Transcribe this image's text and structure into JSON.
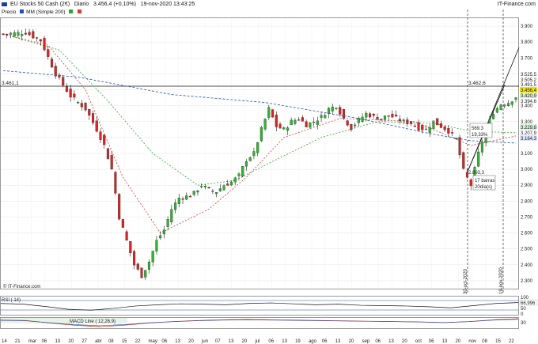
{
  "header": {
    "instrument": "EU Stocks 50 Cash (2€)",
    "timeframe": "Diario",
    "last": "3.456,4 (+0,10%)",
    "datetime": "19-nov-2020 13:43:25",
    "brand": "IT-Finance.com",
    "watermark": "© IT-Finance.com"
  },
  "legend": {
    "price_label": "Precio",
    "ma200_label": "MM (Simple 200)",
    "ma200_color": "#1f4fbf",
    "ma_green_color": "#2ea62e",
    "ma_red_color": "#d43a3a"
  },
  "annotations": {
    "level_left": "3.461,1",
    "level_right": "3.462,6",
    "low_label": "2.893,3",
    "swing_pts": "569,3",
    "swing_pct": "19,33%",
    "bars": "17 barras",
    "days": "20día(s)",
    "vline1": "30-oct-2020",
    "vline2": "19-nov-2020"
  },
  "right_labels": {
    "a": "3.525,5",
    "b": "3.505,2",
    "c": "3.491,5",
    "price": "3.456,4",
    "d": "3.420,9",
    "e": "3.394,6",
    "f": "3.229,8",
    "g": "3.207,9",
    "h": "3.164,3"
  },
  "indicators": {
    "rsi_label": "RSI ( 14)",
    "rsi_value": "66,996",
    "rsi_levels": [
      "100",
      "50",
      "0"
    ],
    "macd_label": "MACD Line ( 12,26,9)",
    "macd_value": "30"
  },
  "chart_data": {
    "type": "candlestick",
    "title": "EU Stocks 50 Cash (2€) — Diario",
    "x_ticks": [
      "14",
      "21",
      "mar",
      "06",
      "13",
      "20",
      "27",
      "abr",
      "08",
      "15",
      "22",
      "may",
      "06",
      "13",
      "20",
      "jun",
      "07",
      "13",
      "20",
      "jul",
      "06",
      "13",
      "19",
      "ago",
      "06",
      "13",
      "20",
      "sep",
      "06",
      "13",
      "20",
      "oct",
      "06",
      "13",
      "20",
      "nov",
      "08",
      "15",
      "22"
    ],
    "y_ticks": [
      3900,
      3800,
      3700,
      3600,
      3500,
      3400,
      3300,
      3200,
      3100,
      3000,
      2900,
      2800,
      2700,
      2600,
      2500,
      2400,
      2300
    ],
    "y_tick_labels": [
      "3.900",
      "3.800",
      "3.700",
      "3.600",
      "3.500",
      "3.400",
      "3.300",
      "3.200",
      "3.100",
      "3.000",
      "2.900",
      "2.800",
      "2.700",
      "2.600",
      "2.500",
      "2.400",
      "2.300"
    ],
    "ylim": [
      2250,
      3950
    ],
    "close_path": [
      [
        0,
        3850
      ],
      [
        6,
        3860
      ],
      [
        10,
        3810
      ],
      [
        14,
        3600
      ],
      [
        18,
        3460
      ],
      [
        22,
        3380
      ],
      [
        25,
        3250
      ],
      [
        27,
        3150
      ],
      [
        29,
        3000
      ],
      [
        31,
        2700
      ],
      [
        33,
        2550
      ],
      [
        35,
        2400
      ],
      [
        37,
        2330
      ],
      [
        39,
        2420
      ],
      [
        41,
        2550
      ],
      [
        43,
        2620
      ],
      [
        45,
        2750
      ],
      [
        47,
        2820
      ],
      [
        49,
        2830
      ],
      [
        51,
        2850
      ],
      [
        53,
        2900
      ],
      [
        55,
        2870
      ],
      [
        57,
        2860
      ],
      [
        59,
        2900
      ],
      [
        61,
        2920
      ],
      [
        63,
        2960
      ],
      [
        65,
        3060
      ],
      [
        67,
        3100
      ],
      [
        69,
        3250
      ],
      [
        71,
        3380
      ],
      [
        73,
        3270
      ],
      [
        75,
        3250
      ],
      [
        77,
        3300
      ],
      [
        79,
        3320
      ],
      [
        81,
        3280
      ],
      [
        83,
        3300
      ],
      [
        85,
        3330
      ],
      [
        87,
        3380
      ],
      [
        89,
        3400
      ],
      [
        91,
        3320
      ],
      [
        93,
        3260
      ],
      [
        95,
        3310
      ],
      [
        97,
        3350
      ],
      [
        99,
        3330
      ],
      [
        101,
        3320
      ],
      [
        103,
        3340
      ],
      [
        105,
        3320
      ],
      [
        107,
        3300
      ],
      [
        109,
        3290
      ],
      [
        111,
        3260
      ],
      [
        113,
        3250
      ],
      [
        115,
        3300
      ],
      [
        117,
        3270
      ],
      [
        119,
        3240
      ],
      [
        121,
        3190
      ],
      [
        123,
        2990
      ],
      [
        125,
        2900
      ],
      [
        127,
        3100
      ],
      [
        129,
        3250
      ],
      [
        131,
        3360
      ],
      [
        133,
        3410
      ],
      [
        135,
        3420
      ],
      [
        137,
        3456
      ]
    ],
    "ma200_path": [
      [
        0,
        3620
      ],
      [
        20,
        3580
      ],
      [
        45,
        3470
      ],
      [
        70,
        3420
      ],
      [
        95,
        3320
      ],
      [
        115,
        3220
      ],
      [
        125,
        3180
      ],
      [
        137,
        3165
      ]
    ],
    "ma_green_path": [
      [
        0,
        3850
      ],
      [
        15,
        3750
      ],
      [
        28,
        3430
      ],
      [
        40,
        3100
      ],
      [
        52,
        2900
      ],
      [
        62,
        2930
      ],
      [
        72,
        3050
      ],
      [
        85,
        3200
      ],
      [
        100,
        3300
      ],
      [
        115,
        3290
      ],
      [
        125,
        3240
      ],
      [
        137,
        3230
      ]
    ],
    "ma_red_path": [
      [
        0,
        3850
      ],
      [
        12,
        3780
      ],
      [
        22,
        3500
      ],
      [
        32,
        2950
      ],
      [
        42,
        2600
      ],
      [
        55,
        2750
      ],
      [
        65,
        2950
      ],
      [
        75,
        3200
      ],
      [
        90,
        3320
      ],
      [
        110,
        3300
      ],
      [
        125,
        3150
      ],
      [
        137,
        3210
      ]
    ],
    "rsi": [
      62,
      58,
      45,
      30,
      25,
      35,
      48,
      55,
      60,
      58,
      55,
      62,
      65,
      60,
      55,
      58,
      52,
      50,
      48,
      44,
      38,
      50,
      62,
      67
    ],
    "macd": [
      10,
      5,
      -30,
      -60,
      -80,
      -60,
      -30,
      -10,
      5,
      15,
      20,
      15,
      10,
      5,
      0,
      -5,
      -10,
      -15,
      -25,
      -10,
      15,
      30
    ]
  }
}
